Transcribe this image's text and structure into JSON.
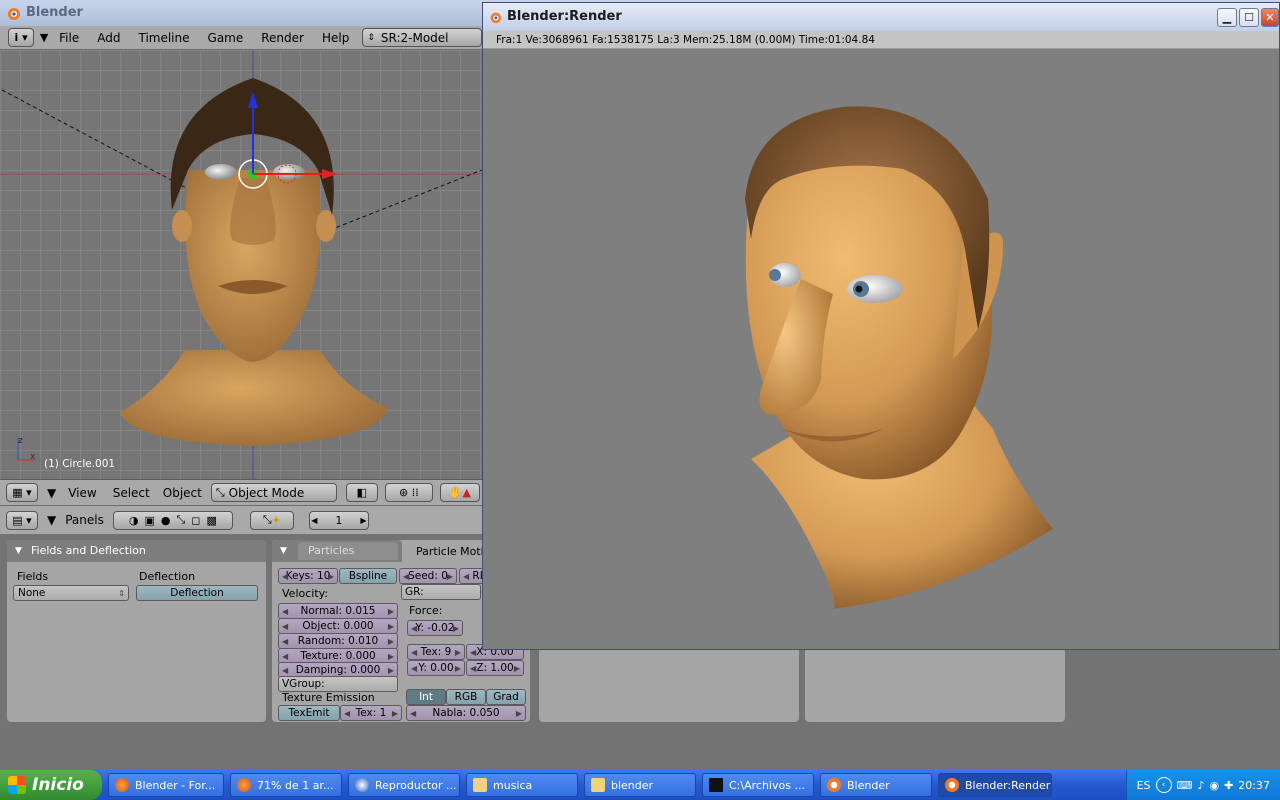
{
  "app": {
    "title": "Blender"
  },
  "menubar": {
    "items": [
      "File",
      "Add",
      "Timeline",
      "Game",
      "Render",
      "Help"
    ],
    "screen": "SR:2-Model"
  },
  "viewport": {
    "object_label": "(1) Circle.001"
  },
  "view_header": {
    "items": [
      "View",
      "Select",
      "Object"
    ],
    "mode": "Object Mode"
  },
  "buttons_header": {
    "panels_label": "Panels",
    "frame": "1"
  },
  "fields_panel": {
    "title": "Fields and Deflection",
    "fields_label": "Fields",
    "fields_value": "None",
    "deflection_label": "Deflection",
    "deflection_button": "Deflection"
  },
  "particles_panel": {
    "tab_particles": "Particles",
    "tab_motion": "Particle Motio",
    "keys": "Keys: 10",
    "bspline": "Bspline",
    "seed": "Seed: 0",
    "rl": "RL",
    "velocity_label": "Velocity:",
    "normal": "Normal: 0.015",
    "object": "Object: 0.000",
    "random": "Random: 0.010",
    "texture": "Texture: 0.000",
    "damping": "Damping: 0.000",
    "vgroup": "VGroup:",
    "gr_label": "GR:",
    "force_label": "Force:",
    "y_force": "Y: -0.02",
    "tex": "Tex: 9",
    "x": "X: 0.00",
    "y": "Y: 0.00",
    "z": "Z: 1.00",
    "texture_emission": "Texture Emission",
    "int": "Int",
    "rgb": "RGB",
    "grad": "Grad",
    "texemit": "TexEmit",
    "tex1": "Tex: 1",
    "nabla": "Nabla: 0.050"
  },
  "render_window": {
    "title": "Blender:Render",
    "info": "Fra:1  Ve:3068961 Fa:1538175 La:3 Mem:25.18M (0.00M) Time:01:04.84"
  },
  "taskbar": {
    "start": "Inicio",
    "tasks": [
      {
        "label": "Blender - For...",
        "icon": "firefox-icon"
      },
      {
        "label": "71% de 1 ar...",
        "icon": "firefox-icon"
      },
      {
        "label": "Reproductor ...",
        "icon": "media-player-icon"
      },
      {
        "label": "musica",
        "icon": "folder-icon"
      },
      {
        "label": "blender",
        "icon": "folder-icon"
      },
      {
        "label": "C:\\Archivos ...",
        "icon": "console-icon"
      },
      {
        "label": "Blender",
        "icon": "blender-icon"
      },
      {
        "label": "Blender:Render",
        "icon": "blender-icon"
      }
    ],
    "lang": "ES",
    "clock": "20:37"
  },
  "colors": {
    "panel_title": "#7d7d7d",
    "render_bg": "#7f7f7f",
    "skin": "#d9a35e"
  }
}
